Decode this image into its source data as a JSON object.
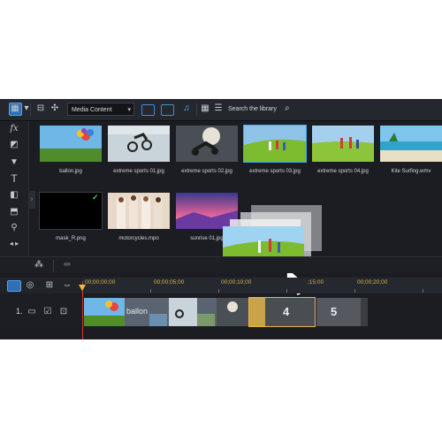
{
  "toolbar": {
    "media_dropdown": "Media Content",
    "search_placeholder": "Search the library"
  },
  "library": {
    "items": [
      {
        "caption": "ballon.jpg"
      },
      {
        "caption": "extreme sports 01.jpg"
      },
      {
        "caption": "extreme sports 02.jpg"
      },
      {
        "caption": "extreme sports 03.jpg"
      },
      {
        "caption": "extreme sports 04.jpg"
      },
      {
        "caption": "Kite Surfing.wmv"
      },
      {
        "caption": "mask_R.png"
      },
      {
        "caption": "motorcycles.mpo"
      },
      {
        "caption": "sunrise 01.jpg"
      }
    ]
  },
  "timeline": {
    "timecodes": [
      "00;00;00;00",
      "00;00;05;00",
      "00;00;10;00",
      ";15;00",
      "00;00;20;00"
    ],
    "track_number": "1.",
    "clip_label": "ballon",
    "clip_numbers": [
      "4",
      "5"
    ]
  },
  "colors": {
    "accent": "#4aa3f0",
    "timecode": "#d9b24a",
    "playhead": "#d23a2a",
    "check": "#54d05a"
  }
}
